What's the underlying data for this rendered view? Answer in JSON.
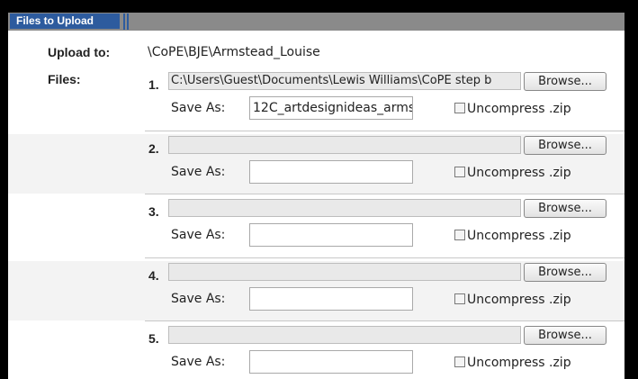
{
  "header": {
    "title": "Files to Upload"
  },
  "upload_to": {
    "label": "Upload to:",
    "path": "\\CoPE\\BJE\\Armstead_Louise"
  },
  "files_label": "Files:",
  "rows": [
    {
      "num": "1.",
      "file": "C:\\Users\\Guest\\Documents\\Lewis Williams\\CoPE step b",
      "browse": "Browse...",
      "save_as_label": "Save As:",
      "save_as": "12C_artdesignideas_arms",
      "uncompress": "Uncompress .zip"
    },
    {
      "num": "2.",
      "file": "",
      "browse": "Browse...",
      "save_as_label": "Save As:",
      "save_as": "",
      "uncompress": "Uncompress .zip"
    },
    {
      "num": "3.",
      "file": "",
      "browse": "Browse...",
      "save_as_label": "Save As:",
      "save_as": "",
      "uncompress": "Uncompress .zip"
    },
    {
      "num": "4.",
      "file": "",
      "browse": "Browse...",
      "save_as_label": "Save As:",
      "save_as": "",
      "uncompress": "Uncompress .zip"
    },
    {
      "num": "5.",
      "file": "",
      "browse": "Browse...",
      "save_as_label": "Save As:",
      "save_as": "",
      "uncompress": "Uncompress .zip"
    }
  ]
}
